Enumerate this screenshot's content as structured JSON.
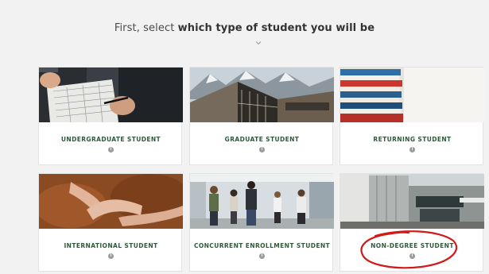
{
  "heading": {
    "prefix": "First, select",
    "emphasis": "which type of student you will be"
  },
  "cards": [
    {
      "label": "UNDERGRADUATE STUDENT",
      "icon": "info-icon",
      "image": "students-writing-at-desk-photo"
    },
    {
      "label": "GRADUATE STUDENT",
      "icon": "info-icon",
      "image": "campus-building-mountains-photo"
    },
    {
      "label": "RETURNING STUDENT",
      "icon": "info-icon",
      "image": "stack-of-books-photo"
    },
    {
      "label": "INTERNATIONAL STUDENT",
      "icon": "info-icon",
      "image": "hands-on-leather-photo"
    },
    {
      "label": "CONCURRENT ENROLLMENT STUDENT",
      "icon": "info-icon",
      "image": "students-walking-hallway-photo"
    },
    {
      "label": "NON-DEGREE STUDENT",
      "icon": "info-icon",
      "image": "modern-building-exterior-photo"
    }
  ],
  "annotation": {
    "color": "#d11a1a",
    "shape": "hand-drawn-circle",
    "target": "NON-DEGREE STUDENT"
  },
  "colors": {
    "label": "#2e5a3a",
    "card_background": "#ffffff",
    "page_background": "#f2f2f2"
  }
}
